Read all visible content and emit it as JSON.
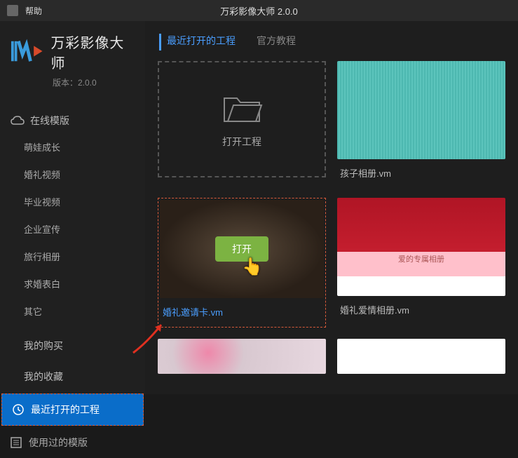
{
  "titlebar": {
    "help": "帮助",
    "title": "万彩影像大师 2.0.0"
  },
  "logo": {
    "name": "万彩影像大师",
    "version": "版本：2.0.0"
  },
  "sidebar": {
    "online_templates": "在线模版",
    "categories": [
      "萌娃成长",
      "婚礼视频",
      "毕业视频",
      "企业宣传",
      "旅行相册",
      "求婚表白",
      "其它"
    ],
    "my_purchase": "我的购买",
    "my_favorites": "我的收藏",
    "recent_projects": "最近打开的工程",
    "used_templates": "使用过的模版"
  },
  "tabs": {
    "recent": "最近打开的工程",
    "official": "官方教程"
  },
  "grid": {
    "open_project": "打开工程",
    "items": [
      {
        "label": "孩子相册.vm"
      },
      {
        "label": "婚礼邀请卡.vm",
        "overlay_text": "打开"
      },
      {
        "label": "婚礼爱情相册.vm"
      }
    ],
    "rose_caption": "爱的专属相册"
  }
}
